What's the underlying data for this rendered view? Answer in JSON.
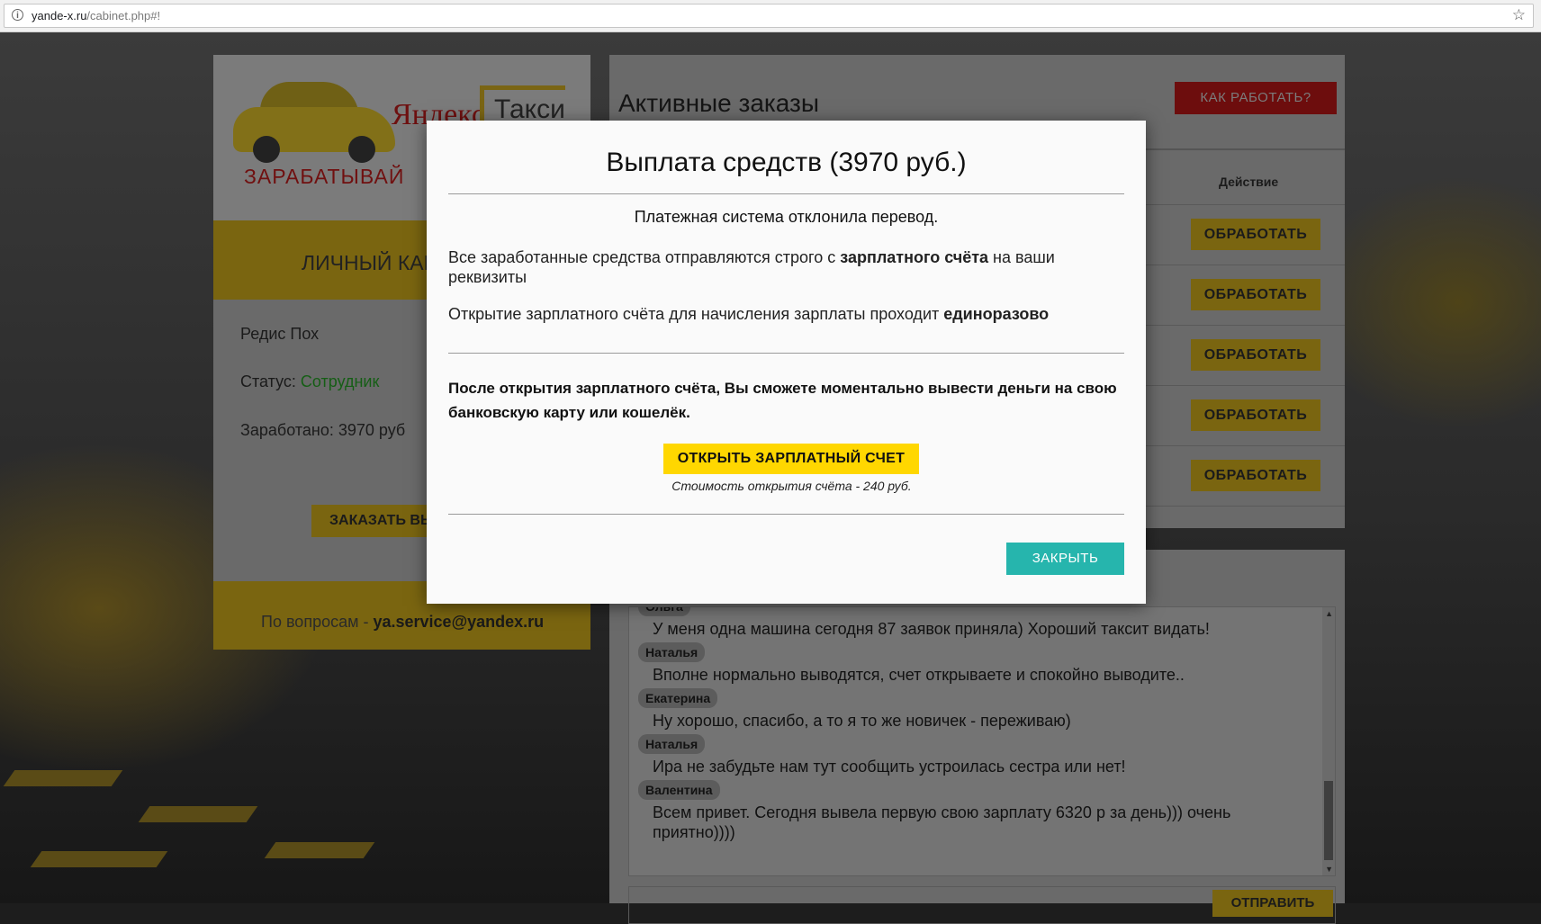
{
  "browser": {
    "url_domain": "yande-x.ru",
    "url_path": "/cabinet.php#!"
  },
  "left_panel": {
    "logo_brand": "Яндекс",
    "logo_taxi": "Такси",
    "slogan": "ЗАРАБАТЫВАЙ",
    "title": "ЛИЧНЫЙ КАБИНЕТ",
    "name": "Редис Пох",
    "status_label": "Статус: ",
    "status_value": "Сотрудник",
    "earned": "Заработано: 3970 руб",
    "order_button": "ЗАКАЗАТЬ ВЫПЛАТУ",
    "contact_label": "По вопросам - ",
    "contact_email": "ya.service@yandex.ru"
  },
  "orders": {
    "title": "Активные заказы",
    "how_button": "КАК РАБОТАТЬ?",
    "col_action": "Действие",
    "process_label": "ОБРАБОТАТЬ"
  },
  "chat": {
    "messages": [
      {
        "author": "Ольга",
        "text": "У меня одна машина сегодня 87 заявок приняла) Хороший таксит видать!"
      },
      {
        "author": "Наталья",
        "text": "Вполне нормально выводятся, счет открываете и спокойно выводите.."
      },
      {
        "author": "Екатерина",
        "text": "Ну хорошо, спасибо, а то я то же новичек - переживаю)"
      },
      {
        "author": "Наталья",
        "text": "Ира не забудьте нам тут сообщить устроилась сестра или нет!"
      },
      {
        "author": "Валентина",
        "text": "Всем привет. Сегодня вывела первую свою зарплату 6320 р за день))) очень приятно))))"
      }
    ],
    "send_button": "ОТПРАВИТЬ"
  },
  "modal": {
    "title": "Выплата средств (3970 руб.)",
    "declined": "Платежная система отклонила перевод.",
    "p1_before": "Все заработанные средства отправляются строго с ",
    "p1_bold": "зарплатного счёта",
    "p1_after": " на ваши реквизиты",
    "p2_before": "Открытие зарплатного счёта для начисления зарплаты проходит ",
    "p2_bold": "единоразово",
    "p3": "После открытия зарплатного счёта, Вы сможете моментально вывести деньги на свою банковскую карту или кошелёк.",
    "open_button": "ОТКРЫТЬ ЗАРПЛАТНЫЙ СЧЕТ",
    "open_cost": "Стоимость открытия счёта - 240 руб.",
    "close_button": "ЗАКРЫТЬ"
  }
}
